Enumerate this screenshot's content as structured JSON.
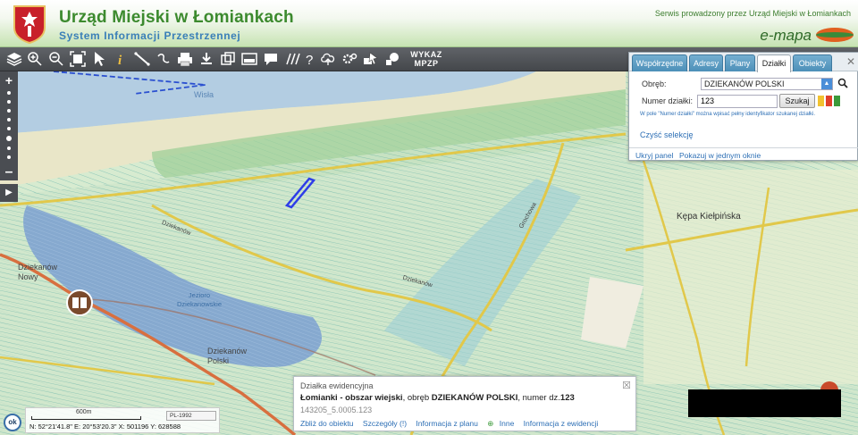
{
  "header": {
    "title": "Urząd Miejski w Łomiankach",
    "subtitle": "System Informacji Przestrzennej",
    "hosted_by": "Serwis prowadzony przez Urząd Miejski w Łomiankach",
    "brand": "e-mapa"
  },
  "toolbar": {
    "icons": [
      "layers-icon",
      "zoom-in-icon",
      "zoom-out-icon",
      "fit-extent-icon",
      "pointer-icon",
      "info-icon",
      "measure-line-icon",
      "measure-area-icon",
      "print-icon",
      "download-icon",
      "export-icon",
      "parcel-icon",
      "comment-icon",
      "hatch-icon",
      "help-icon",
      "upload-icon",
      "settings-icon",
      "identify-icon",
      "note-icon"
    ],
    "wykaz_label": "WYKAZ MPZP"
  },
  "search_panel": {
    "tabs": [
      "Współrzędne",
      "Adresy",
      "Plany",
      "Działki",
      "Obiekty"
    ],
    "active_tab": "Działki",
    "obreb_label": "Obręb:",
    "obreb_value": "DZIEKANÓW POLSKI",
    "numer_label": "Numer działki:",
    "numer_value": "123",
    "search_button": "Szukaj",
    "hint": "W pole \"Numer działki\" można wpisać pełny identyfikator szukanej działki.",
    "clear_link": "Czyść selekcję",
    "hide_panel": "Ukryj panel",
    "single_window": "Pokazuj w jednym oknie",
    "swatch_colors": [
      "#f2c230",
      "#e0402a",
      "#3c9a3a"
    ]
  },
  "info_popup": {
    "heading": "Działka ewidencyjna",
    "main_bold1": "Łomianki - obszar wiejski",
    "main_mid": ", obręb ",
    "main_bold2": "DZIEKANÓW POLSKI",
    "main_mid2": ", numer dz.",
    "main_bold3": "123",
    "parcel_id": "143205_5.0005.123",
    "links": [
      "Zbliż do obiektu",
      "Szczegóły (!)",
      "Informacja z planu",
      "Inne",
      "Informacja z ewidencji"
    ]
  },
  "map": {
    "labels": {
      "wisla": "Wisła",
      "dziekanow_nowy": "Dziekanów Nowy",
      "dziekanow_polski": "Dziekanów Polski",
      "kepa": "Kępa Kiełpińska",
      "jezioro": "Jezioro Dziekanowskie",
      "road1": "Dziekanów",
      "road2": "Dziekanów",
      "road3": "Grochowa"
    }
  },
  "status": {
    "ok_label": "ok",
    "scale_label": "600m",
    "crs": "PL-1992",
    "coords": "N: 52°21'41.8\"  E: 20°53'20.3\"  X: 501196   Y: 628588"
  }
}
